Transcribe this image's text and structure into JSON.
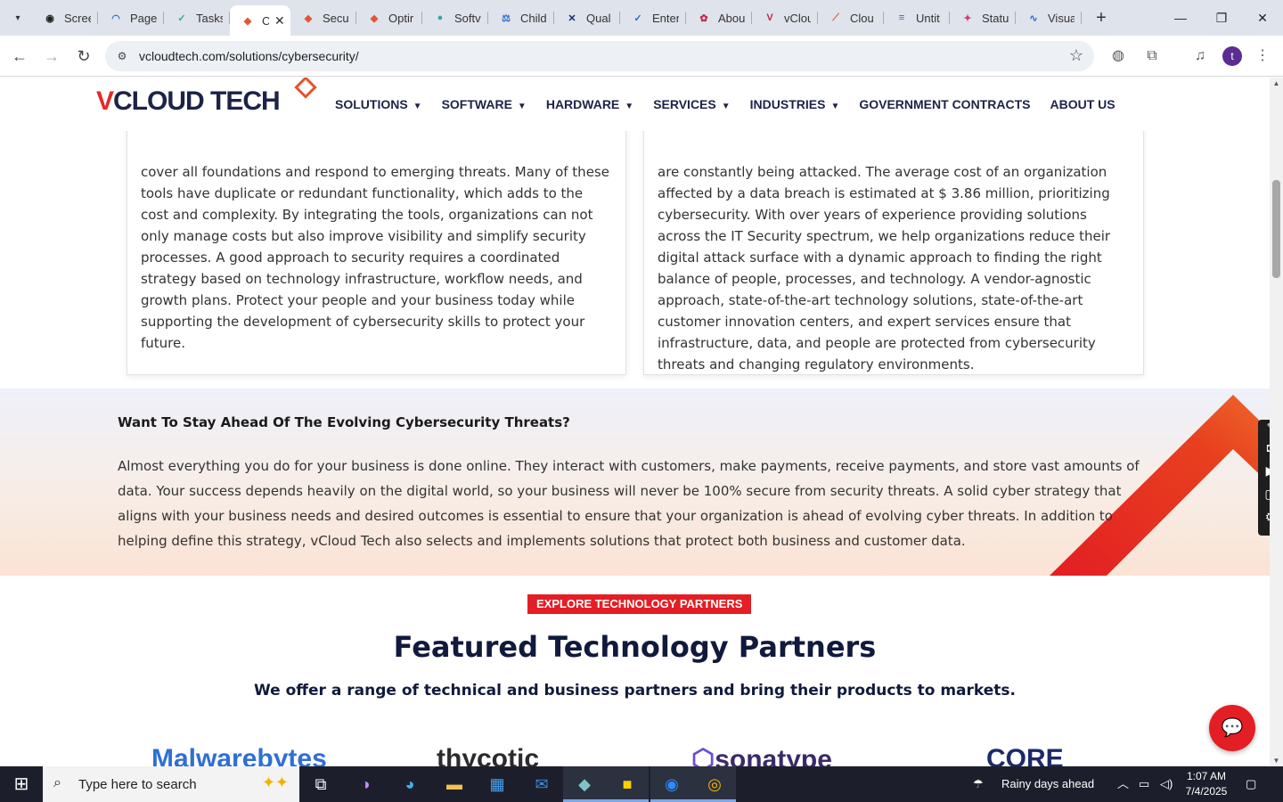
{
  "browser": {
    "tabs": [
      {
        "title": "Scree",
        "icon": "screenshot-app-icon",
        "color": "#1f1f1f",
        "glyph": "◉"
      },
      {
        "title": "Page",
        "icon": "speed-gauge-icon",
        "color": "#2a6ccf",
        "glyph": "◠"
      },
      {
        "title": "Tasks",
        "icon": "tasks-icon",
        "color": "#3aa6a0",
        "glyph": "✓"
      },
      {
        "title": "C",
        "icon": "vcloud-diamond-icon",
        "color": "#e8532d",
        "glyph": "◆",
        "active": true
      },
      {
        "title": "Secu",
        "icon": "vcloud-diamond-icon",
        "color": "#e8532d",
        "glyph": "◆"
      },
      {
        "title": "Optir",
        "icon": "vcloud-diamond-icon",
        "color": "#e8532d",
        "glyph": "◆"
      },
      {
        "title": "Softv",
        "icon": "software-icon",
        "color": "#3aa6a0",
        "glyph": "●"
      },
      {
        "title": "Child",
        "icon": "scales-icon",
        "color": "#2a6ccf",
        "glyph": "⚖"
      },
      {
        "title": "Qual",
        "icon": "x-logo-icon",
        "color": "#1c2a7a",
        "glyph": "✕"
      },
      {
        "title": "Enter",
        "icon": "check-pen-icon",
        "color": "#2a6ccf",
        "glyph": "✓"
      },
      {
        "title": "Abou",
        "icon": "dots-logo-icon",
        "color": "#c0264f",
        "glyph": "✿"
      },
      {
        "title": "vClou",
        "icon": "v-logo-icon",
        "color": "#c0264f",
        "glyph": "V"
      },
      {
        "title": "Clou",
        "icon": "stroke-logo-icon",
        "color": "#e8532d",
        "glyph": "⟋"
      },
      {
        "title": "Untit",
        "icon": "docs-icon",
        "color": "#2a6ccf",
        "glyph": "≡"
      },
      {
        "title": "Statu",
        "icon": "status-icon",
        "color": "#d63384",
        "glyph": "✦"
      },
      {
        "title": "Visua",
        "icon": "pulse-icon",
        "color": "#2a6ccf",
        "glyph": "∿"
      }
    ],
    "url": "vcloudtech.com/solutions/cybersecurity/",
    "profile_initial": "t"
  },
  "site": {
    "logo_text": "VCLOUD TECH",
    "nav": [
      {
        "label": "SOLUTIONS",
        "has_caret": true
      },
      {
        "label": "SOFTWARE",
        "has_caret": true
      },
      {
        "label": "HARDWARE",
        "has_caret": true
      },
      {
        "label": "SERVICES",
        "has_caret": true
      },
      {
        "label": "INDUSTRIES",
        "has_caret": true
      },
      {
        "label": "GOVERNMENT CONTRACTS",
        "has_caret": false
      },
      {
        "label": "ABOUT US",
        "has_caret": false
      }
    ]
  },
  "cards": {
    "left_text": "cover all foundations and respond to emerging threats. Many of these tools have duplicate or redundant functionality, which adds to the cost and complexity. By integrating the tools, organizations can not only manage costs but also improve visibility and simplify security processes. A good approach to security requires a coordinated strategy based on technology infrastructure, workflow needs, and growth plans. Protect your people and your business today while supporting the development of cybersecurity skills to protect your future.",
    "right_text": "are constantly being attacked. The average cost of an organization affected by a data breach is estimated at $ 3.86 million, prioritizing cybersecurity. With over years of experience providing solutions across the IT Security spectrum, we help organizations reduce their digital attack surface with a dynamic approach to finding the right balance of people, processes, and technology. A vendor-agnostic approach, state-of-the-art technology solutions, state-of-the-art customer innovation centers, and expert services ensure that infrastructure, data, and people are protected from cybersecurity threats and changing regulatory environments."
  },
  "band": {
    "heading": "Want To Stay Ahead Of The Evolving Cybersecurity Threats?",
    "text": "Almost everything you do for your business is done online. They interact with customers, make payments, receive payments, and store vast amounts of data. Your success depends heavily on the digital world, so your business will never be 100% secure from security threats. A solid cyber strategy that aligns with your business needs and desired outcomes is essential to ensure that your organization is ahead of evolving cyber threats. In addition to helping define this strategy, vCloud Tech also selects and implements solutions that protect both business and customer data."
  },
  "partners": {
    "cta": "EXPLORE TECHNOLOGY PARTNERS",
    "title": "Featured Technology Partners",
    "subtitle": "We offer a range of technical and business partners and bring their products to markets.",
    "logos": [
      {
        "name": "Malwarebytes",
        "color": "#2f6fd6"
      },
      {
        "name": "thycotic",
        "color": "#2b2b2b"
      },
      {
        "name": "sonatype",
        "color": "#3a2a6a"
      },
      {
        "name": "CORE",
        "color": "#1c2a6a"
      }
    ]
  },
  "taskbar": {
    "search_placeholder": "Type here to search",
    "weather": "Rainy days ahead",
    "time": "1:07 AM",
    "date": "7/4/2025"
  },
  "colors": {
    "brand_red": "#e31e24",
    "brand_navy": "#111a3c",
    "accent_orange": "#e8532d"
  }
}
